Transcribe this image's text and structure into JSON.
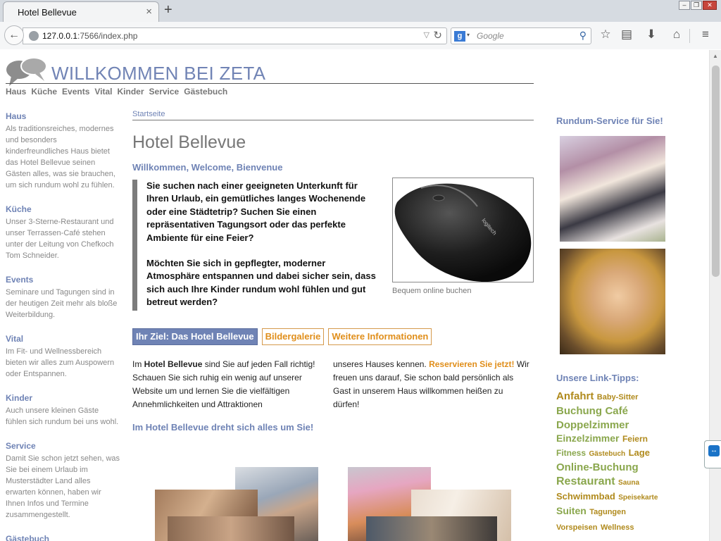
{
  "browser": {
    "tab_title": "Hotel Bellevue",
    "tab_close": "×",
    "new_tab": "+",
    "url_host": "127.0.0.1",
    "url_rest": ":7566/index.php",
    "search_engine_badge": "g",
    "search_placeholder": "Google",
    "icons": [
      "back-icon",
      "globe-icon",
      "reload-icon",
      "search-icon",
      "star-icon",
      "reading-list-icon",
      "download-icon",
      "home-icon",
      "menu-icon"
    ]
  },
  "site": {
    "title": "WILLKOMMEN BEI ZETA",
    "nav": [
      "Haus",
      "Küche",
      "Events",
      "Vital",
      "Kinder",
      "Service",
      "Gästebuch"
    ]
  },
  "sidebar": [
    {
      "heading": "Haus",
      "text": "Als traditionsreiches, modernes und besonders kinderfreundliches Haus bietet das Hotel Bellevue seinen Gästen alles, was sie brauchen, um sich rundum wohl zu fühlen."
    },
    {
      "heading": "Küche",
      "text": "Unser 3-Sterne-Restaurant und unser Terrassen-Café stehen unter der Leitung von Chefkoch Tom Schneider."
    },
    {
      "heading": "Events",
      "text": "Seminare und Tagungen sind in der heutigen Zeit mehr als bloße Weiterbildung."
    },
    {
      "heading": "Vital",
      "text": "Im Fit- und Wellnessbereich bieten wir alles zum Auspowern oder Entspannen."
    },
    {
      "heading": "Kinder",
      "text": "Auch unsere kleinen Gäste fühlen sich rundum bei uns wohl."
    },
    {
      "heading": "Service",
      "text": "Damit Sie schon jetzt sehen, was Sie bei einem Urlaub im Musterstädter Land alles erwarten können, haben wir Ihnen Infos und Termine zusammengestellt."
    },
    {
      "heading": "Gästebuch",
      "text": ""
    }
  ],
  "main": {
    "breadcrumb": "Startseite",
    "heading": "Hotel Bellevue",
    "subheading": "Willkommen, Welcome, Bienvenue",
    "quote_p1": "Sie suchen nach einer geeigneten Unterkunft für Ihren Urlaub, ein gemütliches langes Wochenende oder eine Städtetrip? Suchen Sie einen repräsentativen Tagungsort oder das perfekte Ambiente für eine Feier?",
    "quote_p2": "Möchten Sie sich in gepflegter, moderner Atmosphäre entspannen und dabei sicher sein, dass sich auch Ihre Kinder rundum wohl fühlen und gut betreut werden?",
    "image_caption": "Bequem online buchen",
    "tabs": [
      "Ihr Ziel: Das Hotel Bellevue",
      "Bildergalerie",
      "Weitere Informationen"
    ],
    "col1_pre": "Im ",
    "col1_bold": "Hotel Bellevue",
    "col1_post": " sind Sie auf jeden Fall richtig! Schauen Sie sich ruhig ein wenig auf unserer Website um und lernen Sie die vielfältigen Annehmlichkeiten und Attraktionen",
    "col2_pre": "unseres Hauses kennen. ",
    "col2_link": "Reservieren Sie jetzt!",
    "col2_post": " Wir freuen uns darauf, Sie schon bald persönlich als Gast in unserem Haus willkommen heißen zu dürfen!",
    "tagline": "Im Hotel Bellevue dreht sich alles um Sie!"
  },
  "right": {
    "service_heading": "Rundum-Service für Sie!",
    "links_heading": "Unsere Link-Tipps:",
    "tags": [
      {
        "label": "Anfahrt",
        "size": 15,
        "color": "gold"
      },
      {
        "label": "Baby-Sitter",
        "size": 11,
        "color": "gold"
      },
      {
        "label": "Buchung",
        "size": 15,
        "color": "green"
      },
      {
        "label": "Café",
        "size": 15,
        "color": "green"
      },
      {
        "label": "Doppelzimmer",
        "size": 15,
        "color": "green"
      },
      {
        "label": "Einzelzimmer",
        "size": 14,
        "color": "green"
      },
      {
        "label": "Feiern",
        "size": 12,
        "color": "gold"
      },
      {
        "label": "Fitness",
        "size": 12,
        "color": "green"
      },
      {
        "label": "Gästebuch",
        "size": 10,
        "color": "gold"
      },
      {
        "label": "Lage",
        "size": 13,
        "color": "gold"
      },
      {
        "label": "Online-Buchung",
        "size": 15,
        "color": "green"
      },
      {
        "label": "Restaurant",
        "size": 16,
        "color": "green"
      },
      {
        "label": "Sauna",
        "size": 10,
        "color": "gold"
      },
      {
        "label": "Schwimmbad",
        "size": 13,
        "color": "gold"
      },
      {
        "label": "Speisekarte",
        "size": 10,
        "color": "gold"
      },
      {
        "label": "Suiten",
        "size": 14,
        "color": "green"
      },
      {
        "label": "Tagungen",
        "size": 11,
        "color": "gold"
      },
      {
        "label": "Vorspeisen",
        "size": 11,
        "color": "gold"
      },
      {
        "label": "Wellness",
        "size": 11,
        "color": "gold"
      }
    ]
  },
  "colors": {
    "accent_blue": "#6f83b5",
    "accent_orange": "#e08e1a",
    "tag_gold": "#b08a1c",
    "tag_green": "#8aa74d"
  }
}
